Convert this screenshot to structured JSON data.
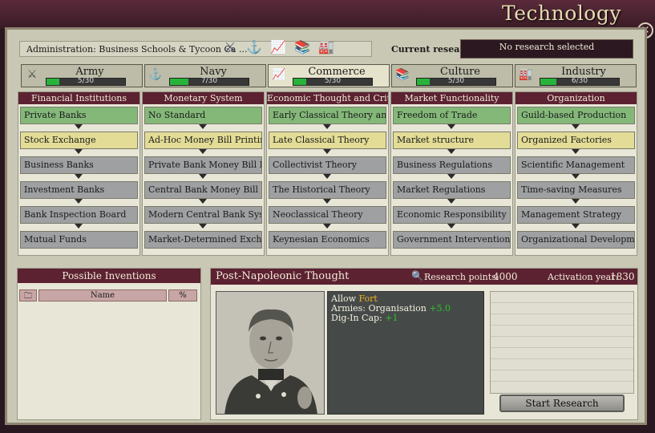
{
  "window": {
    "title": "Technology",
    "close_label": "×"
  },
  "admin": {
    "label": "Administration:  Business Schools & Tycoon Ca ...",
    "icons": [
      "crossed-swords-icon",
      "anchor-icon",
      "chart-add-icon",
      "culture-add-icon",
      "factory-add-icon"
    ]
  },
  "current_research": {
    "label": "Current research:",
    "value": "No research selected"
  },
  "tabs": [
    {
      "label": "Army",
      "icon": "crossed-swords-icon",
      "progress": "5/30",
      "fraction": 0.1667
    },
    {
      "label": "Navy",
      "icon": "anchor-icon",
      "progress": "7/30",
      "fraction": 0.2333
    },
    {
      "label": "Commerce",
      "icon": "chart-icon",
      "progress": "5/30",
      "fraction": 0.1667
    },
    {
      "label": "Culture",
      "icon": "books-icon",
      "progress": "5/30",
      "fraction": 0.1667
    },
    {
      "label": "Industry",
      "icon": "factory-icon",
      "progress": "6/30",
      "fraction": 0.2
    }
  ],
  "columns": [
    {
      "header": "Financial Institutions",
      "techs": [
        {
          "label": "Private Banks",
          "state": "done"
        },
        {
          "label": "Stock Exchange",
          "state": "avail"
        },
        {
          "label": "Business Banks",
          "state": "locked"
        },
        {
          "label": "Investment Banks",
          "state": "locked"
        },
        {
          "label": "Bank Inspection Board",
          "state": "locked"
        },
        {
          "label": "Mutual Funds",
          "state": "locked"
        }
      ]
    },
    {
      "header": "Monetary System",
      "techs": [
        {
          "label": "No Standard",
          "state": "done"
        },
        {
          "label": "Ad-Hoc Money Bill Printing",
          "state": "avail"
        },
        {
          "label": "Private Bank Money Bill P ...",
          "state": "locked"
        },
        {
          "label": "Central Bank Money Bill P ...",
          "state": "locked"
        },
        {
          "label": "Modern Central Bank System",
          "state": "locked"
        },
        {
          "label": "Market-Determined Excha ...",
          "state": "locked"
        }
      ]
    },
    {
      "header": "Economic Thought and Critique",
      "techs": [
        {
          "label": "Early Classical Theory and ...",
          "state": "done"
        },
        {
          "label": "Late Classical Theory",
          "state": "avail"
        },
        {
          "label": "Collectivist Theory",
          "state": "locked"
        },
        {
          "label": "The Historical Theory",
          "state": "locked"
        },
        {
          "label": "Neoclassical Theory",
          "state": "locked"
        },
        {
          "label": "Keynesian Economics",
          "state": "locked"
        }
      ]
    },
    {
      "header": "Market Functionality",
      "techs": [
        {
          "label": "Freedom of Trade",
          "state": "done"
        },
        {
          "label": "Market structure",
          "state": "avail"
        },
        {
          "label": "Business Regulations",
          "state": "locked"
        },
        {
          "label": "Market Regulations",
          "state": "locked"
        },
        {
          "label": "Economic Responsibility",
          "state": "locked"
        },
        {
          "label": "Government Interventionism",
          "state": "locked"
        }
      ]
    },
    {
      "header": "Organization",
      "techs": [
        {
          "label": "Guild-based Production",
          "state": "done"
        },
        {
          "label": "Organized Factories",
          "state": "avail"
        },
        {
          "label": "Scientific Management",
          "state": "locked"
        },
        {
          "label": "Time-saving Measures",
          "state": "locked"
        },
        {
          "label": "Management Strategy",
          "state": "locked"
        },
        {
          "label": "Organizational Development",
          "state": "locked"
        }
      ]
    }
  ],
  "inventions": {
    "header": "Possible Inventions",
    "col_name": "Name",
    "col_pct": "%"
  },
  "detail": {
    "title": "Post-Napoleonic Thought",
    "research_points_label": "Research points:",
    "research_points": "4000",
    "activation_label": "Activation year:",
    "activation_year": "1830",
    "effects": {
      "line1_prefix": "Allow ",
      "line1_value": "Fort",
      "line2_prefix": "Armies: Organisation ",
      "line2_value": "+5.0",
      "line3_prefix": "Dig-In Cap: ",
      "line3_value": "+1"
    },
    "start_button": "Start Research"
  }
}
